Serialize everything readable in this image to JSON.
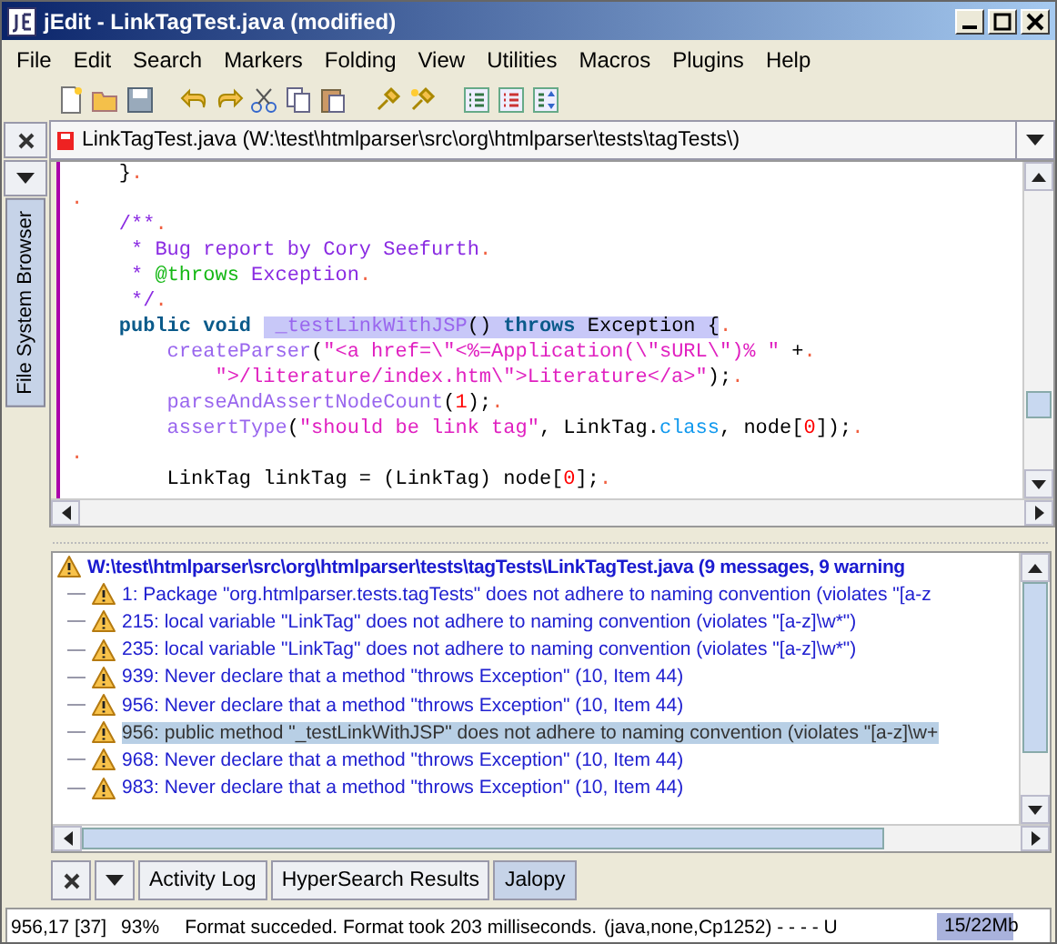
{
  "window": {
    "title": "jEdit - LinkTagTest.java (modified)"
  },
  "menu": [
    "File",
    "Edit",
    "Search",
    "Markers",
    "Folding",
    "View",
    "Utilities",
    "Macros",
    "Plugins",
    "Help"
  ],
  "toolbar": [
    {
      "kind": "new"
    },
    {
      "kind": "open"
    },
    {
      "kind": "save"
    },
    {
      "kind": "sep"
    },
    {
      "kind": "undo"
    },
    {
      "kind": "redo"
    },
    {
      "kind": "cut"
    },
    {
      "kind": "copy"
    },
    {
      "kind": "paste"
    },
    {
      "kind": "sep"
    },
    {
      "kind": "plug"
    },
    {
      "kind": "plug2"
    },
    {
      "kind": "sep"
    },
    {
      "kind": "list"
    },
    {
      "kind": "list2"
    },
    {
      "kind": "list3"
    }
  ],
  "dock_left": {
    "tab": "File System Browser"
  },
  "buffer": {
    "name": "LinkTagTest.java (W:\\test\\htmlparser\\src\\org\\htmlparser\\tests\\tagTests\\)"
  },
  "code_lines": [
    {
      "tokens": [
        {
          "kind": "plain",
          "text": "    }"
        },
        {
          "kind": "eol",
          "text": "."
        }
      ]
    },
    {
      "tokens": [
        {
          "kind": "eol",
          "text": "."
        }
      ]
    },
    {
      "tokens": [
        {
          "kind": "comment",
          "text": "    /**"
        },
        {
          "kind": "eol",
          "text": "."
        }
      ]
    },
    {
      "tokens": [
        {
          "kind": "comment",
          "text": "     * Bug report by Cory Seefurth"
        },
        {
          "kind": "eol",
          "text": "."
        }
      ]
    },
    {
      "tokens": [
        {
          "kind": "comment",
          "text": "     * "
        },
        {
          "kind": "doctag",
          "text": "@throws"
        },
        {
          "kind": "comment",
          "text": " Exception"
        },
        {
          "kind": "eol",
          "text": "."
        }
      ]
    },
    {
      "tokens": [
        {
          "kind": "comment",
          "text": "     */"
        },
        {
          "kind": "eol",
          "text": "."
        }
      ]
    },
    {
      "tokens": [
        {
          "kind": "keyword",
          "text": "    public void "
        },
        {
          "kind": "selected_method",
          "text": " _testLinkWithJSP"
        },
        {
          "kind": "selected",
          "text": "() "
        },
        {
          "kind": "selected_keyword",
          "text": "throws"
        },
        {
          "kind": "selected",
          "text": " Exception {"
        },
        {
          "kind": "eol",
          "text": "."
        }
      ]
    },
    {
      "tokens": [
        {
          "kind": "method",
          "text": "        createParser"
        },
        {
          "kind": "plain",
          "text": "("
        },
        {
          "kind": "string",
          "text": "\"<a href=\\\"<%=Application(\\\"sURL\\\")% \""
        },
        {
          "kind": "plain",
          "text": " +"
        },
        {
          "kind": "eol",
          "text": "."
        }
      ]
    },
    {
      "tokens": [
        {
          "kind": "string",
          "text": "            \">/literature/index.htm\\\">Literature</a>\""
        },
        {
          "kind": "plain",
          "text": ");"
        },
        {
          "kind": "eol",
          "text": "."
        }
      ]
    },
    {
      "tokens": [
        {
          "kind": "method",
          "text": "        parseAndAssertNodeCount"
        },
        {
          "kind": "plain",
          "text": "("
        },
        {
          "kind": "number",
          "text": "1"
        },
        {
          "kind": "plain",
          "text": ");"
        },
        {
          "kind": "eol",
          "text": "."
        }
      ]
    },
    {
      "tokens": [
        {
          "kind": "method",
          "text": "        assertType"
        },
        {
          "kind": "plain",
          "text": "("
        },
        {
          "kind": "string",
          "text": "\"should be link tag\""
        },
        {
          "kind": "plain",
          "text": ", LinkTag."
        },
        {
          "kind": "literal",
          "text": "class"
        },
        {
          "kind": "plain",
          "text": ", node["
        },
        {
          "kind": "number",
          "text": "0"
        },
        {
          "kind": "plain",
          "text": "]);"
        },
        {
          "kind": "eol",
          "text": "."
        }
      ]
    },
    {
      "tokens": [
        {
          "kind": "eol",
          "text": "."
        }
      ]
    },
    {
      "tokens": [
        {
          "kind": "plain",
          "text": "        LinkTag linkTag = (LinkTag) node["
        },
        {
          "kind": "number",
          "text": "0"
        },
        {
          "kind": "plain",
          "text": "];"
        },
        {
          "kind": "eol",
          "text": "."
        }
      ]
    }
  ],
  "messages": [
    {
      "kind": "header",
      "selected": false,
      "text": "W:\\test\\htmlparser\\src\\org\\htmlparser\\tests\\tagTests\\LinkTagTest.java (9 messages, 9 warning"
    },
    {
      "kind": "warning",
      "selected": false,
      "text": "1: Package \"org.htmlparser.tests.tagTests\" does not adhere to naming convention (violates \"[a-z"
    },
    {
      "kind": "warning",
      "selected": false,
      "text": "215: local variable \"LinkTag\" does not adhere to naming convention (violates \"[a-z]\\w*\")"
    },
    {
      "kind": "warning",
      "selected": false,
      "text": "235: local variable \"LinkTag\" does not adhere to naming convention (violates \"[a-z]\\w*\")"
    },
    {
      "kind": "warning",
      "selected": false,
      "text": "939: Never declare that a method \"throws Exception\" (10, Item 44)"
    },
    {
      "kind": "warning",
      "selected": false,
      "text": "956: Never declare that a method \"throws Exception\" (10, Item 44)"
    },
    {
      "kind": "warning",
      "selected": true,
      "text": "956: public method \"_testLinkWithJSP\" does not adhere to naming convention (violates \"[a-z]\\w+"
    },
    {
      "kind": "warning",
      "selected": false,
      "text": "968: Never declare that a method \"throws Exception\" (10, Item 44)"
    },
    {
      "kind": "warning",
      "selected": false,
      "text": "983: Never declare that a method \"throws Exception\" (10, Item 44)"
    }
  ],
  "bottom_tabs": [
    {
      "label": "Activity Log",
      "selected": false
    },
    {
      "label": "HyperSearch Results",
      "selected": false
    },
    {
      "label": "Jalopy",
      "selected": true
    }
  ],
  "status": {
    "caret": "956,17 [37]",
    "percent": "93%",
    "message": "Format succeded. Format took 203 milliseconds.",
    "mode": "(java,none,Cp1252) - - - - U",
    "memory": "15/22Mb",
    "memory_level": {
      "level": 0.68
    }
  }
}
